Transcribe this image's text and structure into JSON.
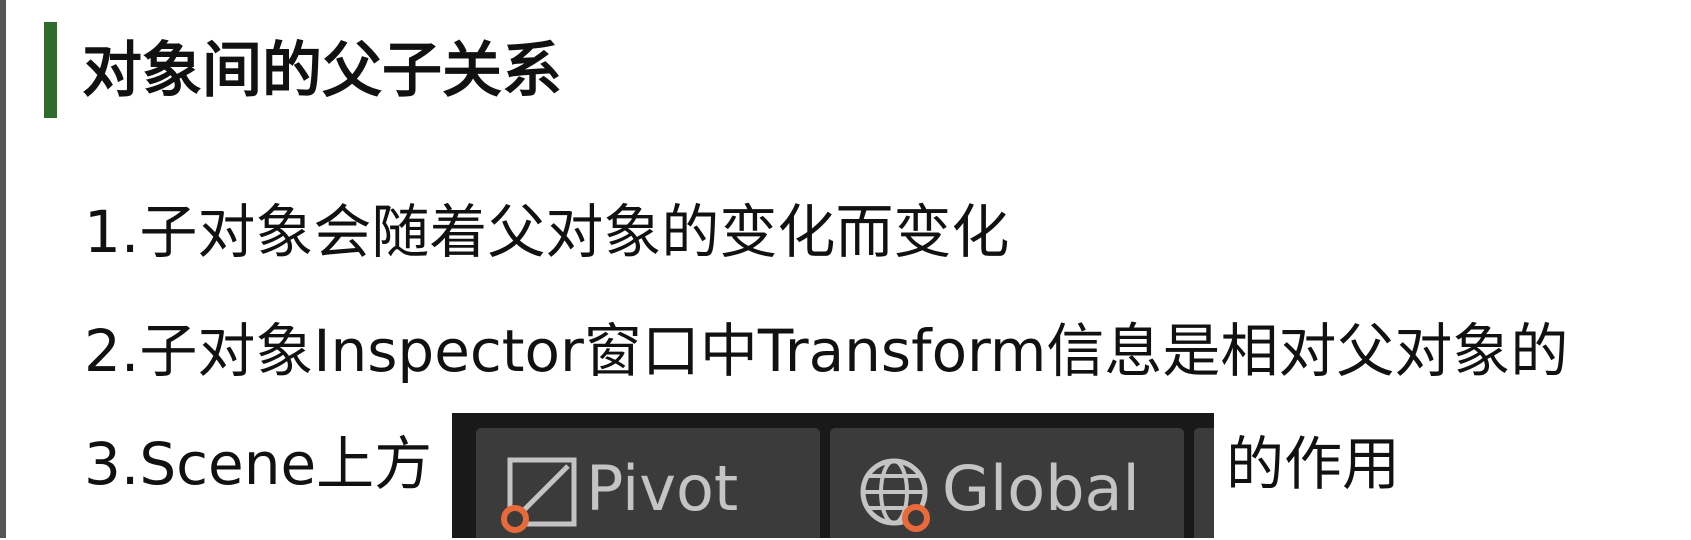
{
  "heading": {
    "title": "对象间的父子关系",
    "accent_color": "#2f6b2d"
  },
  "points": [
    "1.子对象会随着父对象的变化而变化",
    "2.子对象Inspector窗口中Transform信息是相对父对象的",
    "3.Scene上方"
  ],
  "point3_suffix": "的作用",
  "toolbar": {
    "pivot_label": "Pivot",
    "pivot_icon": "pivot-icon",
    "global_label": "Global",
    "global_icon": "globe-icon",
    "accent_color": "#e8693a"
  }
}
